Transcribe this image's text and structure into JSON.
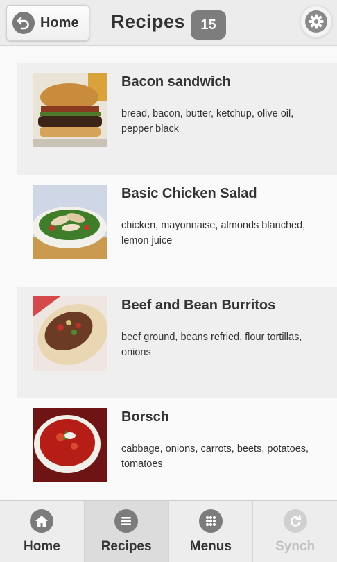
{
  "header": {
    "home_label": "Home",
    "title": "Recipes",
    "count": "15"
  },
  "recipes": [
    {
      "title": "Bacon sandwich",
      "ingredients": "bread, bacon, butter, ketchup, olive oil, pepper black"
    },
    {
      "title": "Basic Chicken Salad",
      "ingredients": "chicken, mayonnaise, almonds blanched, lemon juice"
    },
    {
      "title": "Beef and Bean Burritos",
      "ingredients": "beef ground, beans refried, flour tortillas, onions"
    },
    {
      "title": "Borsch",
      "ingredients": "cabbage, onions, carrots, beets, potatoes, tomatoes"
    }
  ],
  "tabs": [
    {
      "label": "Home",
      "icon": "home-icon",
      "state": "normal"
    },
    {
      "label": "Recipes",
      "icon": "list-icon",
      "state": "active"
    },
    {
      "label": "Menus",
      "icon": "grid-icon",
      "state": "normal"
    },
    {
      "label": "Synch",
      "icon": "refresh-icon",
      "state": "disabled"
    }
  ],
  "colors": {
    "header_bg": "#ececec",
    "badge_bg": "#7d7d7d",
    "row_shaded": "#efefef",
    "icon_gray": "#7c7c7c"
  }
}
